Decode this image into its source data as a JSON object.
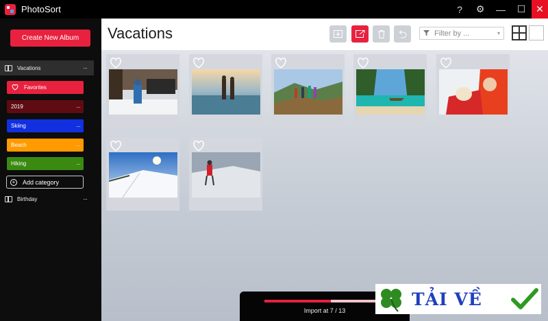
{
  "app": {
    "title": "PhotoSort"
  },
  "window": {
    "help": "?",
    "settings": "⚙",
    "minimize": "—",
    "maximize": "☐",
    "close": "✕"
  },
  "sidebar": {
    "create_button": "Create New Album",
    "albums": [
      {
        "label": "Vacations",
        "more": "···",
        "active": true
      },
      {
        "label": "Birthday",
        "more": "···",
        "active": false
      }
    ],
    "categories": [
      {
        "label": "Favorites",
        "color": "#e8213f",
        "more": ""
      },
      {
        "label": "2019",
        "color": "#5e0b12",
        "more": "···"
      },
      {
        "label": "Skiing",
        "color": "#1230e0",
        "more": "···"
      },
      {
        "label": "Beach",
        "color": "#ff9a00",
        "more": "···"
      },
      {
        "label": "Hiking",
        "color": "#3a8a12",
        "more": "···"
      }
    ],
    "add_category": "Add category",
    "add_icon": "+"
  },
  "header": {
    "title": "Vacations",
    "filter_placeholder": "Filter by ...",
    "filter_caret": "▾"
  },
  "photos": [
    {
      "name": "photo-child-snow-bench"
    },
    {
      "name": "photo-couple-beach-sunset"
    },
    {
      "name": "photo-hikers-mountain"
    },
    {
      "name": "photo-tropical-boat-cliffs"
    },
    {
      "name": "photo-woman-dog-snow"
    },
    {
      "name": "photo-snowy-hill-sun"
    },
    {
      "name": "photo-skier-red-jacket"
    }
  ],
  "import": {
    "label": "Import at 7 / 13",
    "progress": 0.54
  },
  "watermark": {
    "text": "TẢI VỀ"
  },
  "colors": {
    "accent": "#e8213f",
    "sidebar": "#0d0d0d",
    "active_row": "#2e2e2e"
  }
}
